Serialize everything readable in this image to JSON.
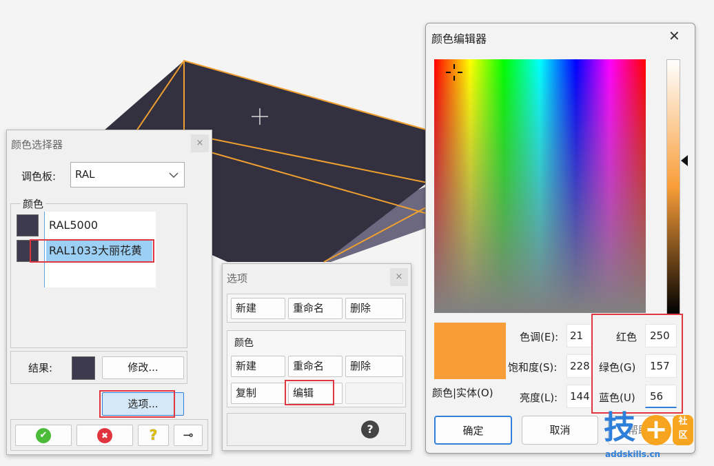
{
  "color_picker": {
    "title": "颜色选择器",
    "close": "×",
    "palette_label": "调色板:",
    "palette_value": "RAL",
    "colors_group": "颜色",
    "color_items": [
      {
        "name": "RAL5000"
      },
      {
        "name": "RAL1033大丽花黄"
      }
    ],
    "result_label": "结果:",
    "modify_button": "修改...",
    "options_button": "选项...",
    "ok_icon": "✔",
    "cancel_icon": "✖",
    "help_icon": "?",
    "pin_icon": "⊸"
  },
  "options_dialog": {
    "title": "选项",
    "close": "×",
    "top_buttons": [
      "新建",
      "重命名",
      "删除"
    ],
    "colors_section": "颜色",
    "color_buttons": [
      "新建",
      "重命名",
      "删除",
      "复制",
      "编辑"
    ],
    "help_icon": "?"
  },
  "color_editor": {
    "title": "颜色编辑器",
    "close": "✕",
    "preview_label": "颜色|实体(O)",
    "hue_label": "色调(E):",
    "hue_value": "21",
    "sat_label": "饱和度(S):",
    "sat_value": "228",
    "lum_label": "亮度(L):",
    "lum_value": "144",
    "red_label": "红色",
    "red_value": "250",
    "green_label": "绿色(G)",
    "green_value": "157",
    "blue_label": "蓝色(U)",
    "blue_value": "56",
    "ok_button": "确定",
    "cancel_button": "取消",
    "third_button": "帮助(H)"
  },
  "watermark": {
    "brand": "技+社区",
    "url": "addskills.cn"
  },
  "colors": {
    "accent_orange": "#f99d38",
    "swatch_dark": "#3c3a4c",
    "annotation_red": "#e0353f",
    "selection_blue": "#5aa6e6",
    "focus_blue": "#2f7ed8"
  }
}
